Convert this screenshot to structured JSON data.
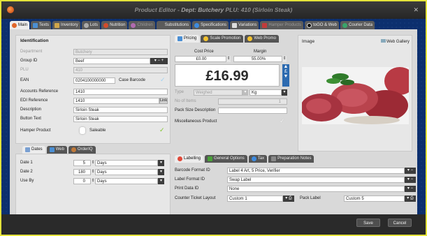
{
  "window": {
    "title_prefix": "Product Editor - ",
    "title_dept": "Dept: Butchery",
    "title_plu": " PLU: 410 (Sirloin Steak)",
    "close": "✕"
  },
  "tabs": [
    {
      "label": "Main",
      "active": true
    },
    {
      "label": "Texts"
    },
    {
      "label": "Inventory"
    },
    {
      "label": "Lots"
    },
    {
      "label": "Nutrition"
    },
    {
      "label": "Children",
      "disabled": true
    },
    {
      "label": "Substitutions"
    },
    {
      "label": "Specifications"
    },
    {
      "label": "Variations"
    },
    {
      "label": "Hamper Products",
      "disabled": true
    },
    {
      "label": "toGO & Web"
    },
    {
      "label": "Courier Data"
    }
  ],
  "identification": {
    "title": "Identification",
    "department_label": "Department",
    "department_value": "Butchery",
    "group_label": "Group ID",
    "group_value": "Beef",
    "plu_label": "PLU",
    "plu_value": "410",
    "ean_label": "EAN",
    "ean_value": "0204100000000",
    "case_barcode": "Case Barcode",
    "accounts_ref_label": "Accounts Reference",
    "accounts_ref_value": "1410",
    "edi_ref_label": "EDI Reference",
    "edi_ref_value": "1410",
    "edi_link": "Link",
    "description_label": "Description",
    "description_value": "Sirloin Steak",
    "button_text_label": "Button Text",
    "button_text_value": "Sirloin Steak",
    "hamper_label": "Hamper Product",
    "saleable_label": "Saleable"
  },
  "date_tabs": [
    {
      "label": "Dates",
      "active": true
    },
    {
      "label": "Web"
    },
    {
      "label": "OrderIQ"
    }
  ],
  "dates": [
    {
      "label": "Date 1",
      "value": "5",
      "unit": "Days"
    },
    {
      "label": "Date 2",
      "value": "180",
      "unit": "Days"
    },
    {
      "label": "Use By",
      "value": "0",
      "unit": "Days"
    }
  ],
  "pricing_tabs": [
    {
      "label": "Pricing",
      "active": true
    },
    {
      "label": "Scale Promotion"
    },
    {
      "label": "Web Promo"
    }
  ],
  "pricing": {
    "cost_price_label": "Cost Price",
    "cost_price_value": "£0.00",
    "margin_label": "Margin",
    "margin_value": "55.00%",
    "price": "£16.99",
    "currency_btn": "£",
    "type_label": "Type",
    "type_value": "Weighed",
    "unit_value": "Kg",
    "no_items_label": "No of Items",
    "no_items_value": "1",
    "pack_size_label": "Pack Size Description",
    "pack_size_value": "",
    "misc_label": "Miscellaneous Product"
  },
  "image": {
    "label": "Image",
    "gallery_btn": "Web Gallery"
  },
  "labelling_tabs": [
    {
      "label": "Labelling",
      "active": true
    },
    {
      "label": "General Options"
    },
    {
      "label": "Tax"
    },
    {
      "label": "Preparation Notes"
    }
  ],
  "labelling": {
    "barcode_format_label": "Barcode Format ID",
    "barcode_format_value": "Label 4 Art, 5 Price, Verifier",
    "label_format_label": "Label Format ID",
    "label_format_value": "Swap Label",
    "print_data_label": "Print Data ID",
    "print_data_value": "None",
    "counter_ticket_label": "Counter Ticket Layout",
    "counter_ticket_value": "Custom 1",
    "pack_label_label": "Pack Label",
    "pack_label_value": "Custom 5"
  },
  "actions": {
    "save": "Save",
    "cancel": "Cancel"
  },
  "colors": {
    "accent_blue": "#2d6bb0",
    "window_border": "#e3e23a",
    "check_green": "#7ec326"
  }
}
